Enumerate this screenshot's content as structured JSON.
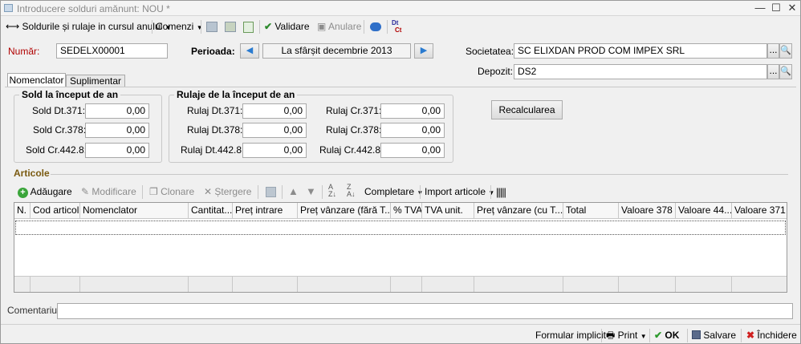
{
  "window": {
    "title": "Introducere solduri amănunt: NOU *"
  },
  "toolbar": {
    "solduri": "Soldurile și rulaje in cursul anului",
    "comenzi": "Comenzi",
    "validare": "Validare",
    "anulare": "Anulare"
  },
  "form": {
    "numar_label": "Număr:",
    "numar_value": "SEDELX00001",
    "perioada_label": "Perioada:",
    "perioada_value": "La sfârșit decembrie 2013",
    "societatea_label": "Societatea:",
    "societatea_value": "SC ELIXDAN PROD COM IMPEX SRL",
    "depozit_label": "Depozit:",
    "depozit_value": "DS2",
    "browse": "..."
  },
  "tabs": [
    "Nomenclator",
    "Suplimentar"
  ],
  "sold": {
    "title": "Sold la început de an",
    "rows": [
      {
        "label": "Sold Dt.371:",
        "value": "0,00"
      },
      {
        "label": "Sold Cr.378:",
        "value": "0,00"
      },
      {
        "label": "Sold Cr.442.8:",
        "value": "0,00"
      }
    ]
  },
  "rulaje": {
    "title": "Rulaje de la început de an",
    "left": [
      {
        "label": "Rulaj Dt.371:",
        "value": "0,00"
      },
      {
        "label": "Rulaj Dt.378:",
        "value": "0,00"
      },
      {
        "label": "Rulaj Dt.442.8:",
        "value": "0,00"
      }
    ],
    "right": [
      {
        "label": "Rulaj Cr.371:",
        "value": "0,00"
      },
      {
        "label": "Rulaj Cr.378:",
        "value": "0,00"
      },
      {
        "label": "Rulaj Cr.442.8:",
        "value": "0,00"
      }
    ]
  },
  "recalculare": "Recalcularea",
  "articole": {
    "title": "Articole",
    "adaugare": "Adăugare",
    "modificare": "Modificare",
    "clonare": "Clonare",
    "stergere": "Ștergere",
    "completare": "Completare",
    "import": "Import articole"
  },
  "columns": [
    "N.",
    "Cod articol",
    "Nomenclator",
    "Cantitat...",
    "Preț intrare",
    "Preț vânzare (fără T...",
    "% TVA",
    "TVA unit.",
    "Preț vânzare (cu T...",
    "Total",
    "Valoare 378",
    "Valoare 44...",
    "Valoare 371"
  ],
  "comentariu_label": "Comentariu:",
  "comentariu_value": "",
  "footer": {
    "formular": "Formular implicit",
    "print": "Print",
    "ok": "OK",
    "salvare": "Salvare",
    "inchidere": "Închidere"
  }
}
